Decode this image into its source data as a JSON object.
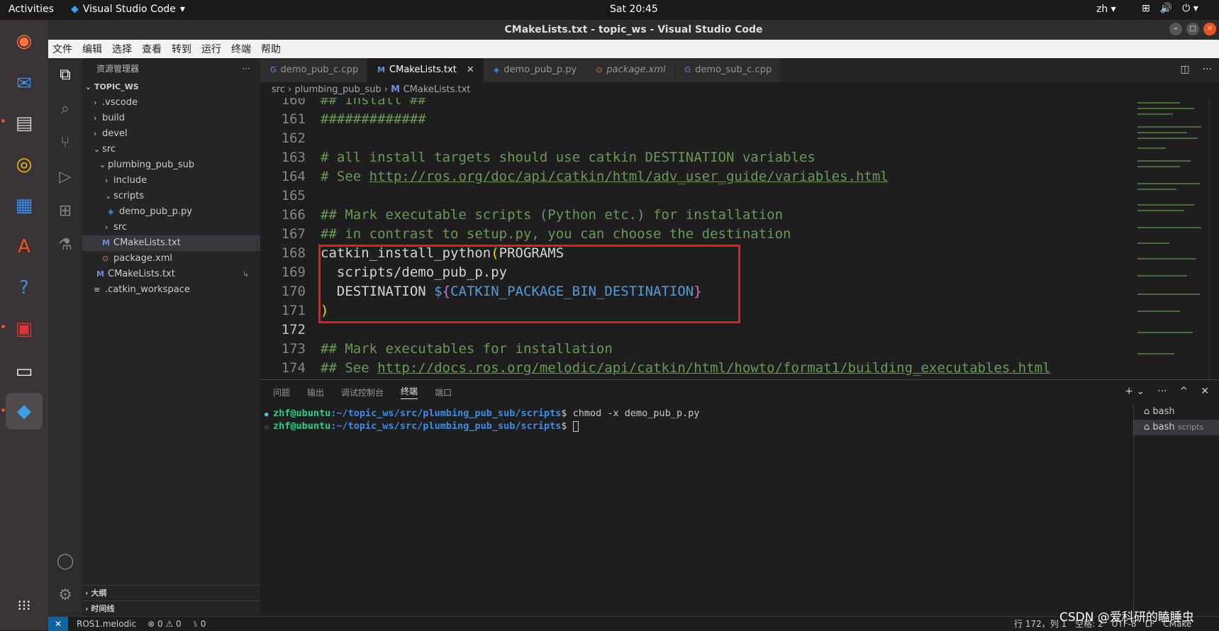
{
  "topbar": {
    "activities": "Activities",
    "app_name": "Visual Studio Code",
    "clock": "Sat 20:45",
    "lang": "zh"
  },
  "window": {
    "title": "CMakeLists.txt - topic_ws - Visual Studio Code"
  },
  "menu": [
    "文件",
    "编辑",
    "选择",
    "查看",
    "转到",
    "运行",
    "终端",
    "帮助"
  ],
  "sidebar": {
    "header": "资源管理器",
    "more": "···",
    "root": "TOPIC_WS",
    "items": [
      {
        "label": ".vscode",
        "chev": "›",
        "icon": ""
      },
      {
        "label": "build",
        "chev": "›",
        "icon": ""
      },
      {
        "label": "devel",
        "chev": "›",
        "icon": ""
      },
      {
        "label": "src",
        "chev": "⌄",
        "icon": ""
      },
      {
        "label": "plumbing_pub_sub",
        "chev": "⌄",
        "icon": ""
      },
      {
        "label": "include",
        "chev": "›",
        "icon": ""
      },
      {
        "label": "scripts",
        "chev": "⌄",
        "icon": ""
      },
      {
        "label": "demo_pub_p.py",
        "chev": "",
        "icon": "py"
      },
      {
        "label": "src",
        "chev": "›",
        "icon": ""
      },
      {
        "label": "CMakeLists.txt",
        "chev": "",
        "icon": "M"
      },
      {
        "label": "package.xml",
        "chev": "",
        "icon": "rss"
      },
      {
        "label": "CMakeLists.txt",
        "chev": "",
        "icon": "M"
      },
      {
        "label": ".catkin_workspace",
        "chev": "",
        "icon": "≡"
      }
    ],
    "outline": "大纲",
    "timeline": "时间线"
  },
  "tabs": [
    {
      "label": "demo_pub_c.cpp",
      "active": false
    },
    {
      "label": "CMakeLists.txt",
      "active": true
    },
    {
      "label": "demo_pub_p.py",
      "active": false
    },
    {
      "label": "package.xml",
      "active": false
    },
    {
      "label": "demo_sub_c.cpp",
      "active": false
    }
  ],
  "breadcrumb": {
    "part1": "src",
    "part2": "plumbing_pub_sub",
    "part3": "CMakeLists.txt"
  },
  "code": {
    "l160n": "160",
    "l160": "## Install ##",
    "l161n": "161",
    "l161": "#############",
    "l162n": "162",
    "l163n": "163",
    "l163": "# all install targets should use catkin DESTINATION variables",
    "l164n": "164",
    "l164a": "# See ",
    "l164b": "http://ros.org/doc/api/catkin/html/adv_user_guide/variables.html",
    "l165n": "165",
    "l166n": "166",
    "l166": "## Mark executable scripts (Python etc.) for installation",
    "l167n": "167",
    "l167": "## in contrast to setup.py, you can choose the destination",
    "l168n": "168",
    "l168a": "catkin_install_python",
    "l168b": "(",
    "l168c": "PROGRAMS",
    "l169n": "169",
    "l169": "  scripts/demo_pub_p.py",
    "l170n": "170",
    "l170a": "  DESTINATION ",
    "l170b": "$",
    "l170c": "{",
    "l170d": "CATKIN_PACKAGE_BIN_DESTINATION",
    "l170e": "}",
    "l171n": "171",
    "l171": ")",
    "l172n": "172",
    "l173n": "173",
    "l173": "## Mark executables for installation",
    "l174n": "174",
    "l174a": "## See ",
    "l174b": "http://docs.ros.org/melodic/api/catkin/html/howto/format1/building_executables.html"
  },
  "panel": {
    "tabs": [
      "问题",
      "输出",
      "调试控制台",
      "终端",
      "端口"
    ],
    "active": "终端",
    "t1_user": "zhf@ubuntu",
    "t1_path": ":~/topic_ws/src/plumbing_pub_sub/scripts",
    "t1_cmd": "$ chmod -x demo_pub_p.py",
    "t2_user": "zhf@ubuntu",
    "t2_path": ":~/topic_ws/src/plumbing_pub_sub/scripts",
    "t2_cmd": "$ ",
    "terminals": [
      {
        "label": "bash",
        "sub": ""
      },
      {
        "label": "bash",
        "sub": "scripts"
      }
    ]
  },
  "status": {
    "remote": "✕",
    "ros": "ROS1.melodic",
    "errors": "⊗ 0 ⚠ 0",
    "ports": "⑊ 0",
    "position": "行 172，列 1",
    "spaces": "空格: 2",
    "encoding": "UTF-8",
    "eol": "LF",
    "lang": "CMake"
  },
  "watermark": "CSDN @爱科研的瞌睡虫"
}
